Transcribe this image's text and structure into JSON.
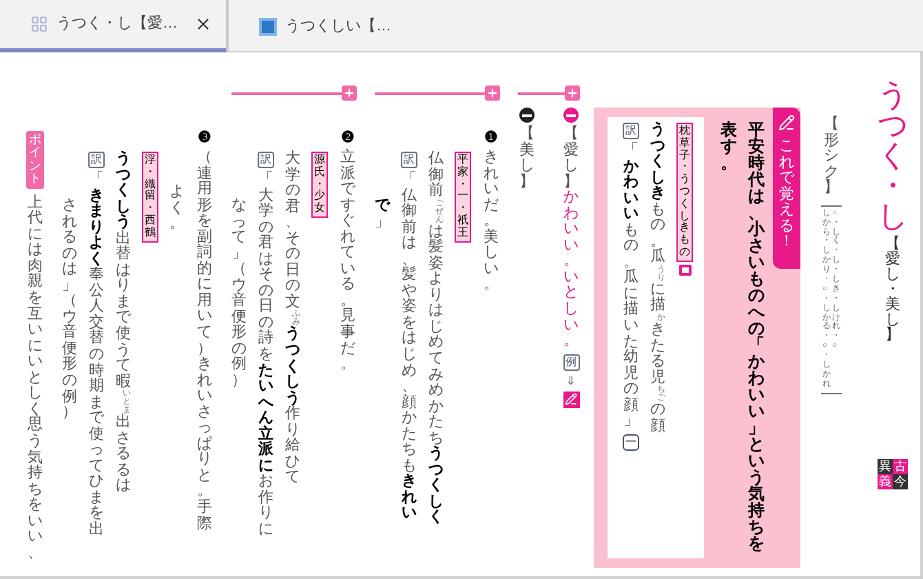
{
  "tabs": [
    {
      "label": "うつく・し【愛…",
      "selected": true
    },
    {
      "label": "うつくしい【…",
      "selected": false
    }
  ],
  "headword": {
    "title": "うつく・し",
    "kanji": "【愛し・美し】",
    "badge": [
      {
        "text": "異",
        "color": "#333333"
      },
      {
        "text": "古",
        "color": "#e8198b"
      },
      {
        "text": "義",
        "color": "#e8198b"
      },
      {
        "text": "今",
        "color": "#333333"
      }
    ]
  },
  "part_of_speech": "【形シク】",
  "conjugation": [
    "しから・しかり・○・しかる・○・しかれ",
    "○・しく・し・しき・しけれ・○"
  ],
  "memo": {
    "tab": "これで覚える！",
    "lines": [
      "表す。",
      "平安時代は、小さいものへの「かわいい」という気持ちを"
    ],
    "example": [
      {
        "kind": "trans",
        "label": "訳",
        "segments": [
          {
            "text": "「"
          },
          {
            "text": "かわいい",
            "bold": true
          },
          {
            "text": "もの。瓜に描いた幼児の顔」"
          }
        ],
        "end_mark": "一"
      },
      {
        "kind": "quote",
        "segments": [
          {
            "text": "うつくしき",
            "bold": true
          },
          {
            "text": "もの。瓜"
          },
          {
            "ruby": "うり"
          },
          {
            "text": "に描"
          },
          {
            "ruby": "か"
          },
          {
            "text": "きたる児"
          },
          {
            "ruby": "ちご"
          },
          {
            "text": "の顔"
          }
        ]
      },
      {
        "kind": "source",
        "text": "枕草子・うつくしきもの",
        "note_icon": true
      }
    ]
  },
  "groups": [
    {
      "toggle": false,
      "columns": [
        {
          "kind": "cont",
          "segments": [
            {
              "text": "されるのは」（ウ音便形の例）"
            }
          ]
        },
        {
          "kind": "trans",
          "label": "訳",
          "segments": [
            {
              "text": "「"
            },
            {
              "text": "きまりよく",
              "bold": true
            },
            {
              "text": "奉公人交替の時期まで使ってひまを出"
            }
          ]
        },
        {
          "kind": "quote",
          "segments": [
            {
              "text": "うつくしう",
              "bold": true
            },
            {
              "text": "出替はりまで使うて暇"
            },
            {
              "ruby": "いとま"
            },
            {
              "text": "出さるるは"
            }
          ]
        },
        {
          "kind": "source",
          "text": "浮・織留・西鶴"
        },
        {
          "kind": "cont_short",
          "segments": [
            {
              "text": "よく。"
            }
          ]
        },
        {
          "kind": "sense",
          "number": "❸",
          "segments": [
            {
              "text": "（連用形を副詞的に用いて）きれいさっぱりと。手際"
            }
          ]
        }
      ]
    },
    {
      "toggle": true,
      "columns": [
        {
          "kind": "cont",
          "segments": [
            {
              "text": "なって」（ウ音便形の例）"
            }
          ]
        },
        {
          "kind": "trans",
          "label": "訳",
          "segments": [
            {
              "text": "「大学の君はその日の詩を"
            },
            {
              "text": "たいへん立派に",
              "bold": true
            },
            {
              "text": "お作りに"
            }
          ]
        },
        {
          "kind": "quote",
          "segments": [
            {
              "text": "大学の君、その日の文"
            },
            {
              "ruby": "ふみ"
            },
            {
              "text": "うつくしう",
              "bold": true
            },
            {
              "text": "作り給ひて"
            }
          ]
        },
        {
          "kind": "source",
          "text": "源氏・少女"
        },
        {
          "kind": "sense",
          "number": "❷",
          "segments": [
            {
              "text": "立派ですぐれている。見事だ。"
            }
          ]
        }
      ]
    },
    {
      "toggle": true,
      "columns": [
        {
          "kind": "cont",
          "segments": [
            {
              "text": "で",
              "bold": true
            },
            {
              "text": "」"
            }
          ]
        },
        {
          "kind": "trans",
          "label": "訳",
          "segments": [
            {
              "text": "「仏御前は、髪や姿をはじめ、顔かたちも"
            },
            {
              "text": "きれい",
              "bold": true
            }
          ]
        },
        {
          "kind": "quote",
          "segments": [
            {
              "text": "仏御前"
            },
            {
              "ruby": "ごぜん"
            },
            {
              "text": "は髪姿よりはじめてみめかたち"
            },
            {
              "text": "うつくしく",
              "bold": true
            }
          ]
        },
        {
          "kind": "source",
          "text": "平家・一・祇王"
        },
        {
          "kind": "sense",
          "number": "❶",
          "segments": [
            {
              "text": "きれいだ。美しい。"
            }
          ]
        }
      ]
    },
    {
      "toggle": true,
      "columns": [
        {
          "kind": "heading",
          "color": "#222222",
          "segments": [
            {
              "text": "【美し】"
            }
          ]
        },
        {
          "kind": "heading",
          "color": "#e8198b",
          "segments": [
            {
              "text": "【愛し】"
            },
            {
              "text": "かわいい。いとしい。",
              "accent": true
            }
          ],
          "ref": "例",
          "arrow": "⇓",
          "pen": true
        }
      ]
    }
  ],
  "point": {
    "badge": "ポイント",
    "text": "上代には肉親を互いにいとしく思う気持ちをいい、"
  }
}
